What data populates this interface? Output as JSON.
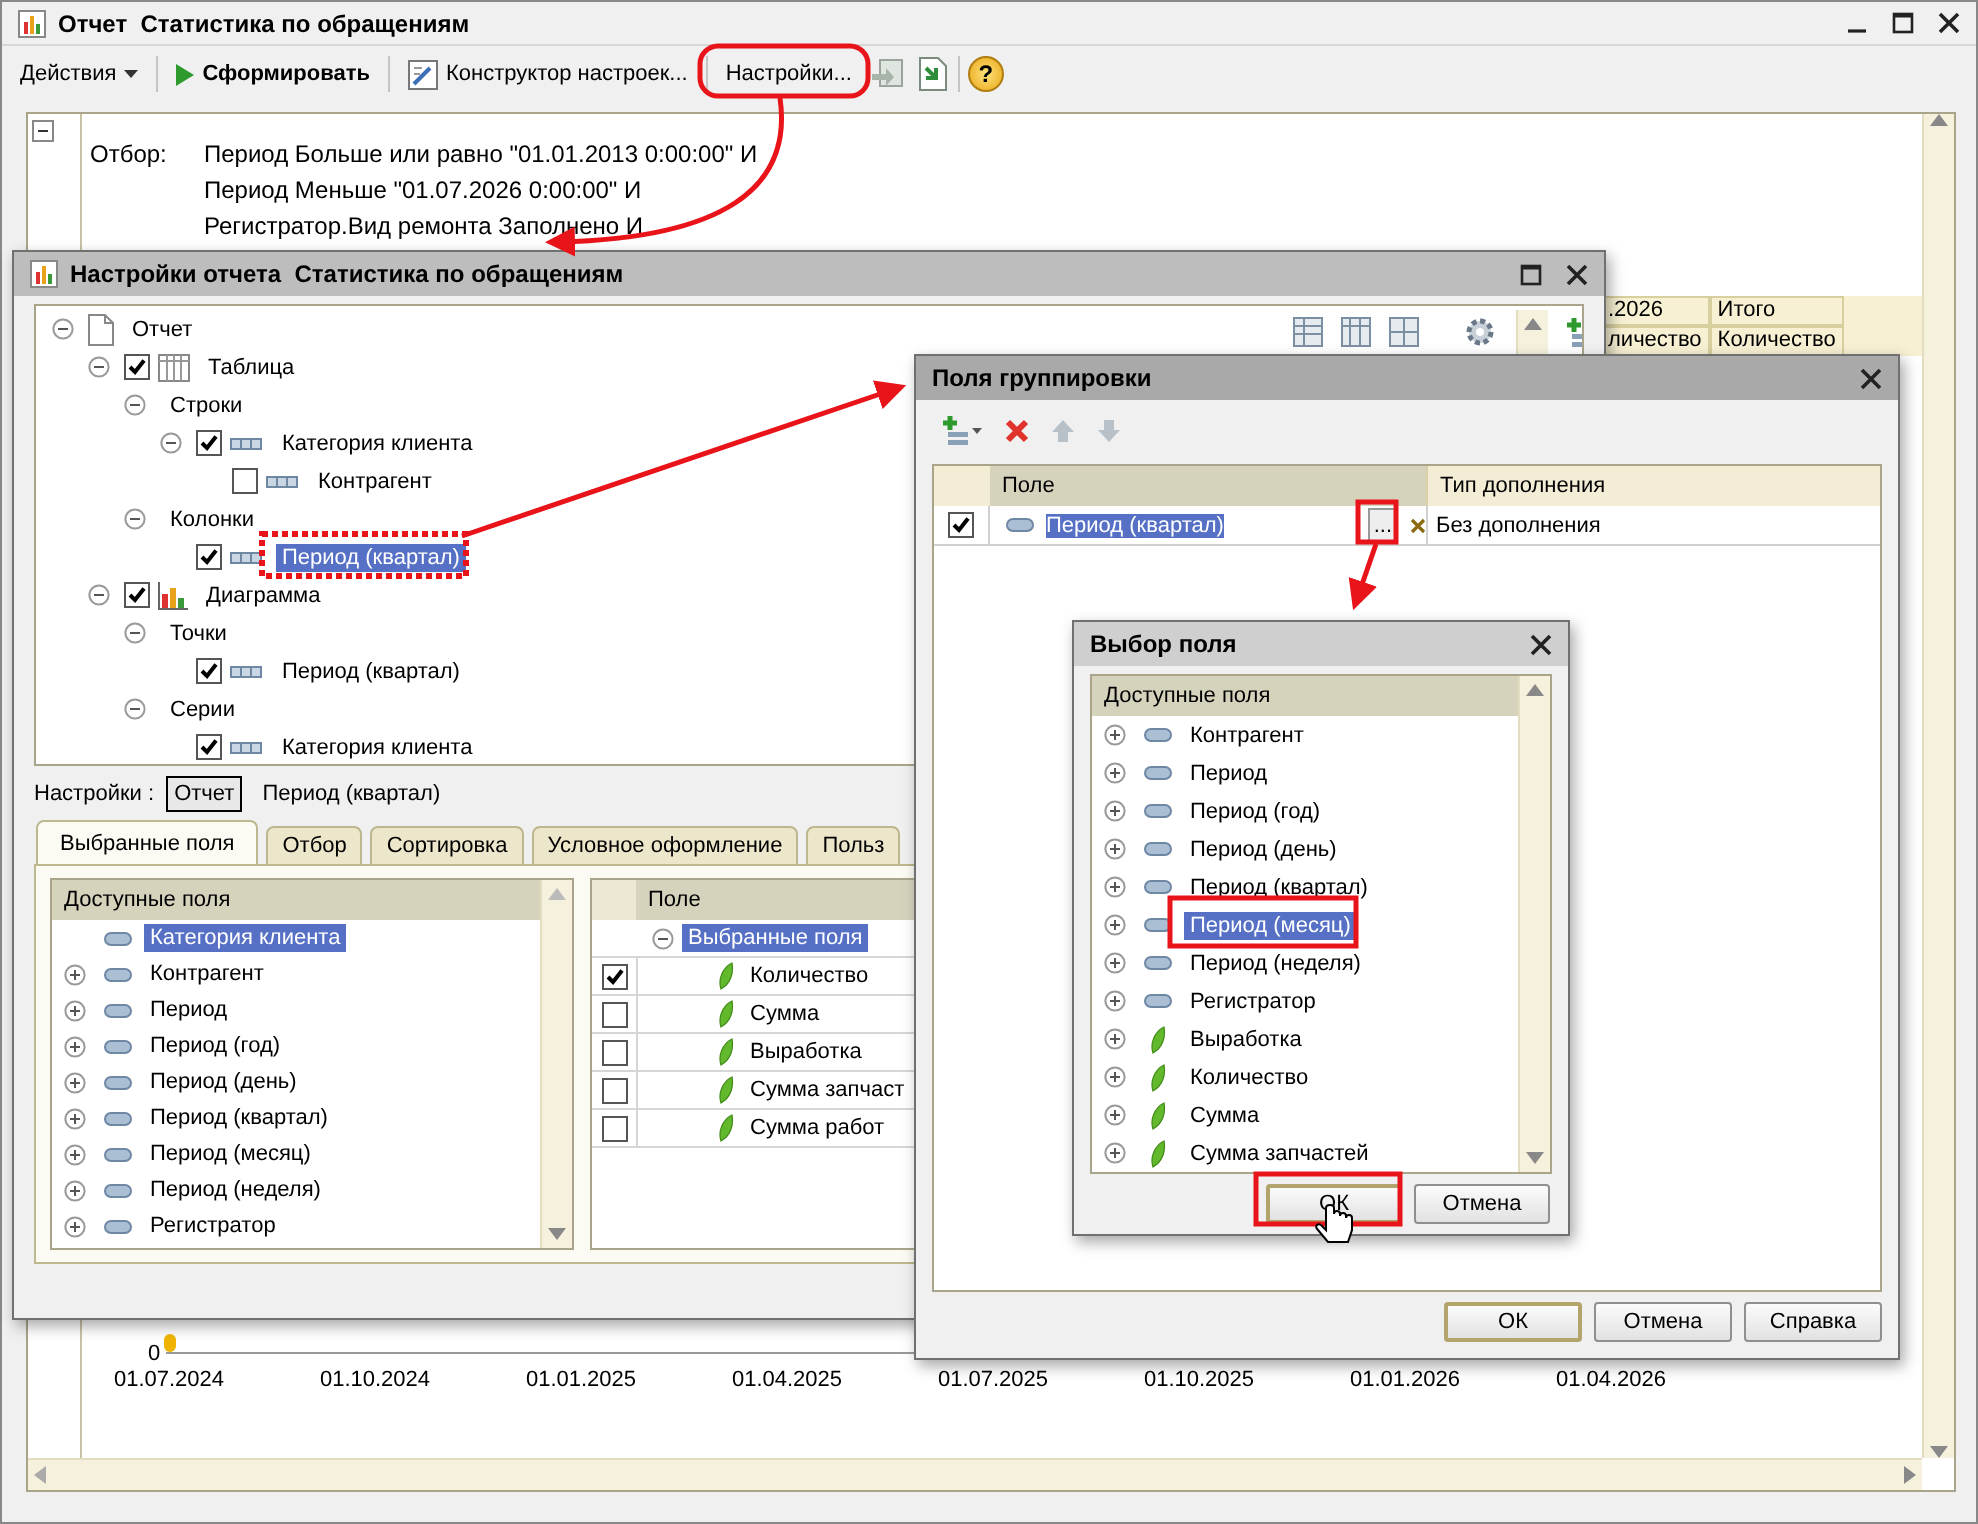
{
  "main_window": {
    "title": "Отчет  Статистика по обращениям",
    "toolbar": [
      {
        "kind": "menu",
        "label": "Действия"
      },
      {
        "kind": "run",
        "label": "Сформировать"
      },
      {
        "kind": "wizard",
        "label": "Конструктор настроек..."
      },
      {
        "kind": "plain",
        "label": "Настройки..."
      },
      {
        "kind": "load"
      },
      {
        "kind": "save"
      },
      {
        "kind": "help",
        "label": "?"
      }
    ],
    "report": {
      "filter_label": "Отбор:",
      "filter_lines": [
        "Период Больше или равно \"01.01.2013 0:00:00\" И",
        "Период Меньше \"01.07.2026 0:00:00\" И",
        "Регистратор.Вид ремонта Заполнено И"
      ],
      "header_cells": [
        ".2026",
        "Итого",
        "личество",
        "Количество"
      ]
    },
    "chart": {
      "y_tick": "0",
      "x_labels": [
        "01.07.2024",
        "01.10.2024",
        "01.01.2025",
        "01.04.2025",
        "01.07.2025",
        "01.10.2025",
        "01.01.2026",
        "01.04.2026"
      ]
    }
  },
  "settings_window": {
    "title": "Настройки отчета  Статистика по обращениям",
    "tree": [
      {
        "kind": "report",
        "label": "Отчет",
        "expanded": true,
        "selected": false,
        "children": [
          {
            "kind": "table",
            "label": "Таблица",
            "expanded": true,
            "checked": true,
            "selected": false,
            "children": [
              {
                "kind": "group",
                "label": "Строки",
                "expanded": true,
                "selected": false,
                "children": [
                  {
                    "kind": "field",
                    "label": "Категория клиента",
                    "expanded": true,
                    "checked": true,
                    "selected": false,
                    "children": [
                      {
                        "kind": "field",
                        "label": "Контрагент",
                        "checked": false,
                        "selected": false
                      }
                    ]
                  }
                ]
              },
              {
                "kind": "group",
                "label": "Колонки",
                "expanded": true,
                "selected": false,
                "children": [
                  {
                    "kind": "field",
                    "label": "Период (квартал)",
                    "checked": true,
                    "selected": true
                  }
                ]
              }
            ]
          },
          {
            "kind": "chart",
            "label": "Диаграмма",
            "expanded": true,
            "checked": true,
            "selected": false,
            "children": [
              {
                "kind": "group",
                "label": "Точки",
                "expanded": true,
                "selected": false,
                "children": [
                  {
                    "kind": "field",
                    "label": "Период (квартал)",
                    "checked": true,
                    "selected": false
                  }
                ]
              },
              {
                "kind": "group",
                "label": "Серии",
                "expanded": true,
                "selected": false,
                "children": [
                  {
                    "kind": "field",
                    "label": "Категория клиента",
                    "checked": true,
                    "selected": false
                  }
                ]
              }
            ]
          }
        ]
      }
    ],
    "settings_label": "Настройки :",
    "settings_targets": [
      {
        "label": "Отчет",
        "selected": true
      },
      {
        "label": "Период (квартал)",
        "selected": false
      }
    ],
    "tabs": [
      {
        "label": "Выбранные поля",
        "selected": true
      },
      {
        "label": "Отбор",
        "selected": false
      },
      {
        "label": "Сортировка",
        "selected": false
      },
      {
        "label": "Условное оформление",
        "selected": false
      },
      {
        "label": "Польз",
        "selected": false
      }
    ],
    "available_fields": {
      "header": "Доступные поля",
      "items": [
        {
          "label": "Категория клиента",
          "kind": "dimension",
          "expandable": false,
          "selected": true
        },
        {
          "label": "Контрагент",
          "kind": "dimension",
          "expandable": true,
          "selected": false
        },
        {
          "label": "Период",
          "kind": "dimension",
          "expandable": true,
          "selected": false
        },
        {
          "label": "Период (год)",
          "kind": "dimension",
          "expandable": true,
          "selected": false
        },
        {
          "label": "Период (день)",
          "kind": "dimension",
          "expandable": true,
          "selected": false
        },
        {
          "label": "Период (квартал)",
          "kind": "dimension",
          "expandable": true,
          "selected": false
        },
        {
          "label": "Период (месяц)",
          "kind": "dimension",
          "expandable": true,
          "selected": false
        },
        {
          "label": "Период (неделя)",
          "kind": "dimension",
          "expandable": true,
          "selected": false
        },
        {
          "label": "Регистратор",
          "kind": "dimension",
          "expandable": true,
          "selected": false
        }
      ]
    },
    "selected_fields": {
      "header": "Поле",
      "rows": [
        {
          "kind": "group",
          "label": "Выбранные поля",
          "expanded": true,
          "selected": true
        },
        {
          "kind": "field",
          "label": "Количество",
          "checked": true
        },
        {
          "kind": "field",
          "label": "Сумма",
          "checked": false
        },
        {
          "kind": "field",
          "label": "Выработка",
          "checked": false
        },
        {
          "kind": "field",
          "label": "Сумма запчаст",
          "checked": false
        },
        {
          "kind": "field",
          "label": "Сумма работ",
          "checked": false
        }
      ]
    }
  },
  "grouping_window": {
    "title": "Поля группировки",
    "columns": [
      "Поле",
      "Тип дополнения"
    ],
    "rows": [
      {
        "checked": true,
        "field": "Период (квартал)",
        "selected": true,
        "ellipsis": "...",
        "addition": "Без дополнения"
      }
    ],
    "buttons": [
      {
        "label": "ОК",
        "default": true
      },
      {
        "label": "Отмена",
        "default": false
      },
      {
        "label": "Справка",
        "default": false
      }
    ]
  },
  "field_choice_window": {
    "title": "Выбор поля",
    "header": "Доступные поля",
    "items": [
      {
        "label": "Контрагент",
        "kind": "dimension",
        "expandable": true,
        "selected": false
      },
      {
        "label": "Период",
        "kind": "dimension",
        "expandable": true,
        "selected": false
      },
      {
        "label": "Период (год)",
        "kind": "dimension",
        "expandable": true,
        "selected": false
      },
      {
        "label": "Период (день)",
        "kind": "dimension",
        "expandable": true,
        "selected": false
      },
      {
        "label": "Период (квартал)",
        "kind": "dimension",
        "expandable": true,
        "selected": false
      },
      {
        "label": "Период (месяц)",
        "kind": "dimension",
        "expandable": true,
        "selected": true
      },
      {
        "label": "Период (неделя)",
        "kind": "dimension",
        "expandable": true,
        "selected": false
      },
      {
        "label": "Регистратор",
        "kind": "dimension",
        "expandable": true,
        "selected": false
      },
      {
        "label": "Выработка",
        "kind": "resource",
        "expandable": true,
        "selected": false
      },
      {
        "label": "Количество",
        "kind": "resource",
        "expandable": true,
        "selected": false
      },
      {
        "label": "Сумма",
        "kind": "resource",
        "expandable": true,
        "selected": false
      },
      {
        "label": "Сумма запчастей",
        "kind": "resource",
        "expandable": true,
        "selected": false
      }
    ],
    "buttons": [
      {
        "label": "ОК",
        "default": true
      },
      {
        "label": "Отмена",
        "default": false
      }
    ]
  }
}
